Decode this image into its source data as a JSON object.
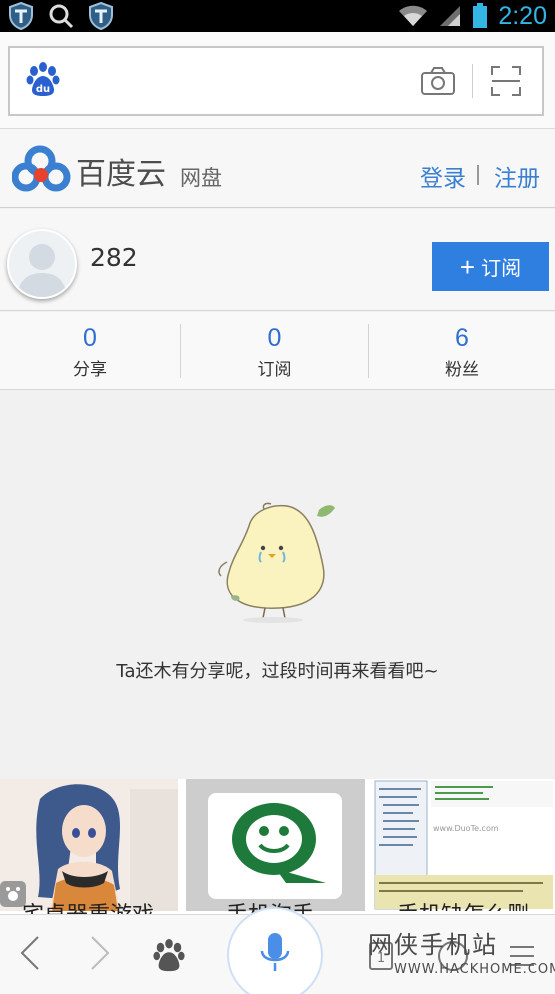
{
  "status_bar": {
    "time": "2:20",
    "icons": [
      "shield-icon",
      "search-icon",
      "shield-icon",
      "wifi-icon",
      "signal-icon",
      "battery-icon"
    ]
  },
  "search_bar": {
    "logo_text": "du",
    "icons": [
      "baidu-paw-icon",
      "camera-icon",
      "scan-icon"
    ]
  },
  "header": {
    "brand": "百度云",
    "product": "网盘",
    "login": "登录",
    "separator": "|",
    "register": "注册",
    "brand_colors": [
      "#3b7fd0",
      "#e8412c"
    ]
  },
  "profile": {
    "username": "282",
    "subscribe_label": "订阅",
    "subscribe_plus": "+"
  },
  "stats": [
    {
      "value": "0",
      "label": "分享"
    },
    {
      "value": "0",
      "label": "订阅"
    },
    {
      "value": "6",
      "label": "粉丝"
    }
  ],
  "empty_state": {
    "message": "Ta还木有分享呢，过段时间再来看看吧~"
  },
  "thumbnails": [
    {
      "caption": "宅桌器重游戏",
      "image": "anime-girl-image"
    },
    {
      "caption": "手机淘手",
      "image": "green-smiley-logo-image"
    },
    {
      "caption": "手机缺怎么删",
      "image": "software-window-screenshot-image",
      "inner_text": "www.DuoTe.com"
    }
  ],
  "bottom_bar": {
    "items": [
      "back-arrow-icon",
      "forward-arrow-icon",
      "baidu-paw-icon",
      "microphone-icon",
      "tabs-icon",
      "home-icon",
      "menu-icon"
    ]
  },
  "watermark": {
    "text_cn": "网侠手机站",
    "text_en": "WWW.HACKHOME.COM"
  },
  "accent_color": "#2f7fe0"
}
